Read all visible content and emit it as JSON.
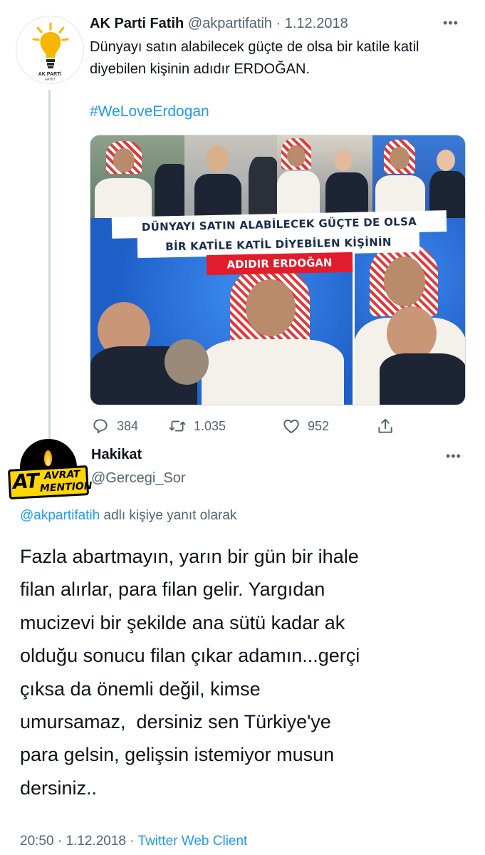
{
  "parent_tweet": {
    "author_name": "AK Parti Fatih",
    "handle": "@akpartifatih",
    "separator": "·",
    "date": "1.12.2018",
    "more": "•••",
    "avatar_brand_line1": "AK PARTİ",
    "avatar_brand_line2": "FATİH",
    "text": "Dünyayı satın alabilecek güçte de olsa bir katile katil diyebilen kişinin adıdır ERDOĞAN.",
    "hashtag": "#WeLoveErdogan",
    "image_captions": {
      "line1": "DÜNYAYI SATIN ALABİLECEK GÜÇTE DE OLSA",
      "line2": "BİR KATİLE KATİL DİYEBİLEN KİŞİNİN",
      "line3": "ADIDIR ERDOĞAN"
    },
    "actions": {
      "reply_count": "384",
      "retweet_count": "1.035",
      "like_count": "952",
      "reply_icon": "reply-icon",
      "retweet_icon": "retweet-icon",
      "like_icon": "heart-icon",
      "share_icon": "share-icon"
    },
    "colors": {
      "link": "#1d9bf0",
      "muted": "#536471",
      "banner_red": "#e11d2b"
    }
  },
  "reply_tweet": {
    "author_name": "Hakikat",
    "handle": "@Gercegi_Sor",
    "more": "•••",
    "stamp_big": "AT",
    "stamp_top": "AVRAT",
    "stamp_bottom": "MENTION",
    "replying_to_handle": "@akpartifatih",
    "replying_to_suffix": "adlı kişiye yanıt olarak",
    "body_lines": [
      "Fazla abartmayın, yarın bir gün bir ihale",
      "filan alırlar, para filan gelir. Yargıdan",
      "mucizevi bir şekilde ana sütü kadar ak",
      "olduğu sonucu filan çıkar adamın...gerçi",
      "çıksa da önemli değil, kimse",
      "umursamaz,  dersiniz sen Türkiye'ye",
      "para gelsin, gelişsin istemiyor musun",
      "dersiniz.."
    ],
    "time": "20:50",
    "separator": "·",
    "date": "1.12.2018",
    "client": "Twitter Web Client"
  }
}
